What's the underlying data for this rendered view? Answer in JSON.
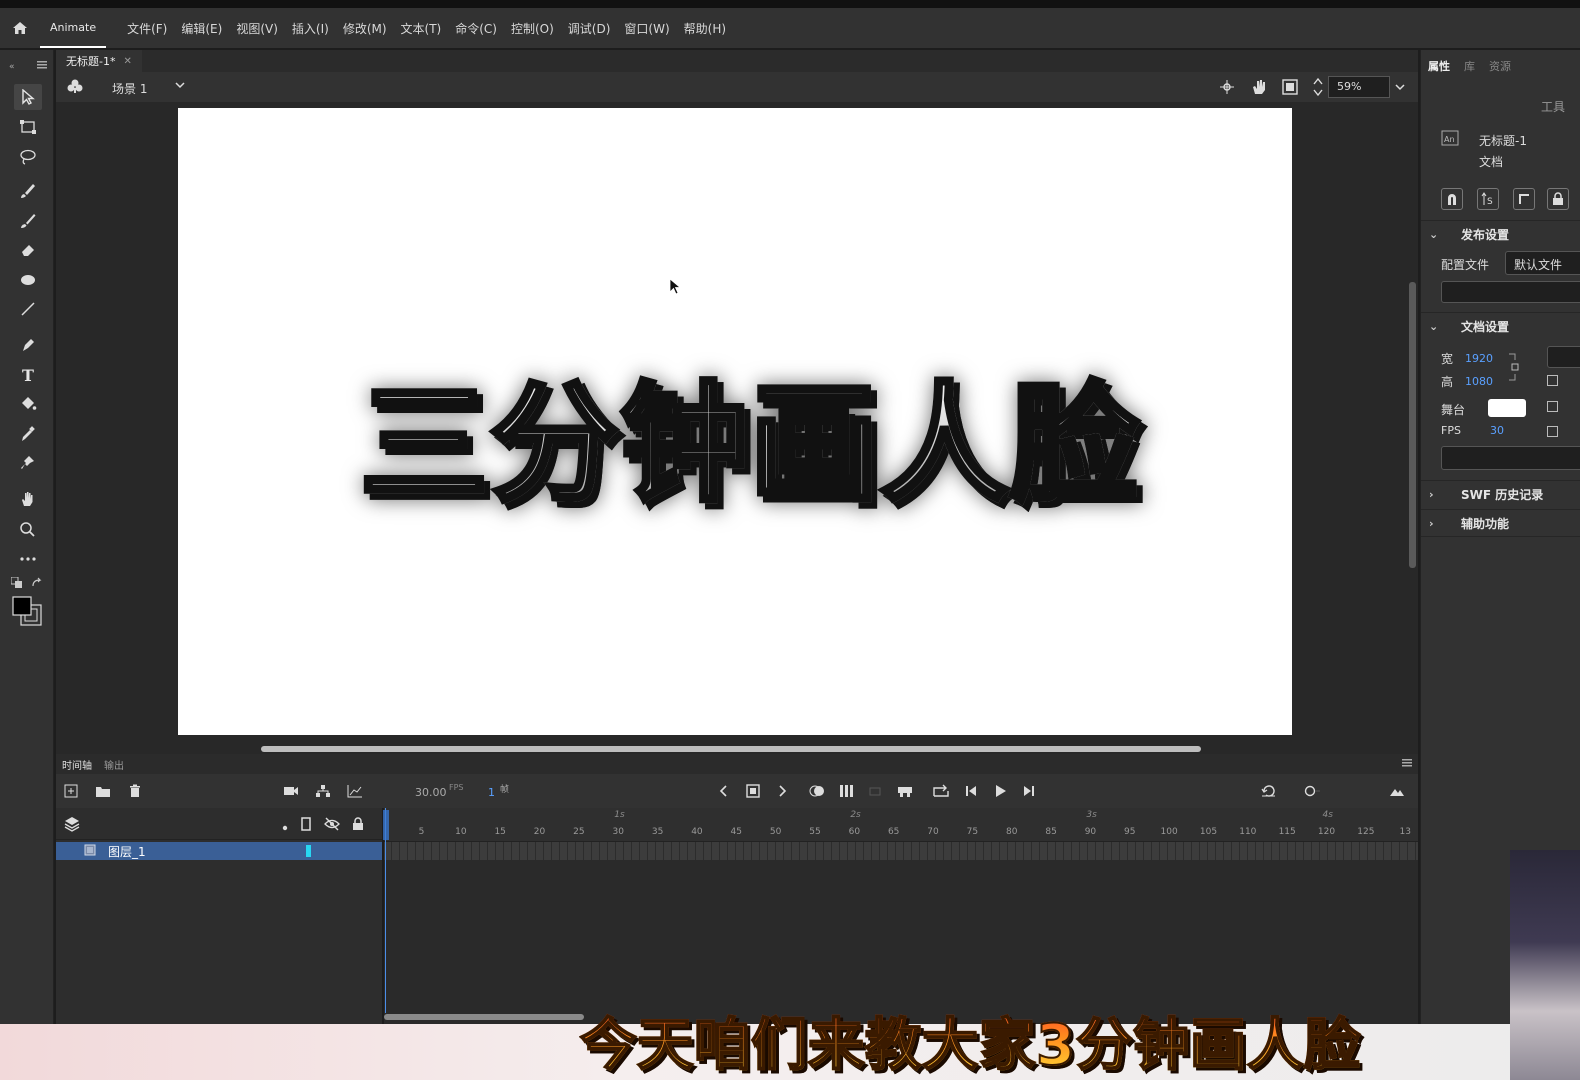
{
  "menubar": {
    "app_name": "Animate",
    "items": [
      "文件(F)",
      "编辑(E)",
      "视图(V)",
      "插入(I)",
      "修改(M)",
      "文本(T)",
      "命令(C)",
      "控制(O)",
      "调试(D)",
      "窗口(W)",
      "帮助(H)"
    ]
  },
  "document": {
    "tab_label": "无标题-1*",
    "scene_label": "场景 1",
    "zoom": "59%"
  },
  "stage": {
    "title_text": "三分钟画人脸"
  },
  "timeline": {
    "tabs": [
      "时间轴",
      "输出"
    ],
    "fps_value": "30.00",
    "fps_unit": "FPS",
    "frame_value": "1",
    "frame_unit": "帧",
    "layer_name": "图层_1",
    "seconds": [
      "1s",
      "2s",
      "3s",
      "4s"
    ],
    "frame_ticks": [
      "5",
      "10",
      "15",
      "20",
      "25",
      "30",
      "35",
      "40",
      "45",
      "50",
      "55",
      "60",
      "65",
      "70",
      "75",
      "80",
      "85",
      "90",
      "95",
      "100",
      "105",
      "110",
      "115",
      "120",
      "125",
      "13"
    ]
  },
  "properties": {
    "tabs": [
      "属性",
      "库",
      "资源"
    ],
    "tools_label": "工具",
    "doc_name": "无标题-1",
    "doc_type": "文档",
    "publish_section": "发布设置",
    "profile_label": "配置文件",
    "profile_value": "默认文件",
    "doc_section": "文档设置",
    "width_label": "宽",
    "width_value": "1920",
    "height_label": "高",
    "height_value": "1080",
    "stage_label": "舞台",
    "fps_label": "FPS",
    "fps_value": "30",
    "swf_history": "SWF 历史记录",
    "accessibility": "辅助功能"
  },
  "subtitle": "今天咱们来教大家3分钟画人脸",
  "colors": {
    "accent": "#3a7bd5",
    "layer_highlight": "#3a5f96",
    "stage_bg": "#ffffff"
  }
}
